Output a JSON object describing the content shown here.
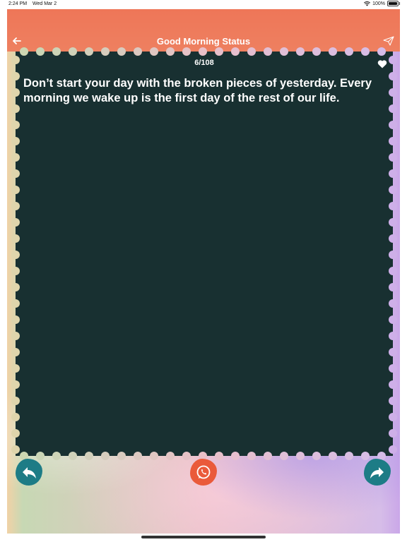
{
  "status_bar": {
    "time": "2:24 PM",
    "date": "Wed Mar 2",
    "battery": "100%"
  },
  "navbar": {
    "title": "Good Morning Status",
    "back_icon": "back-arrow-icon",
    "send_icon": "paper-plane-icon"
  },
  "card": {
    "counter": "6/108",
    "quote": "Don’t start your day with the broken pieces of yesterday. Every morning we wake up is the first day of the rest of our life.",
    "favorite_icon": "heart-icon",
    "background_color": "#183031"
  },
  "bottom_bar": {
    "back_button_icon": "reply-arrow-icon",
    "whatsapp_button_icon": "whatsapp-icon",
    "share_button_icon": "share-arrow-icon"
  },
  "colors": {
    "navbar": "#ee7658",
    "teal_button": "#1d7c86",
    "whatsapp_button": "#ea5a3a"
  }
}
